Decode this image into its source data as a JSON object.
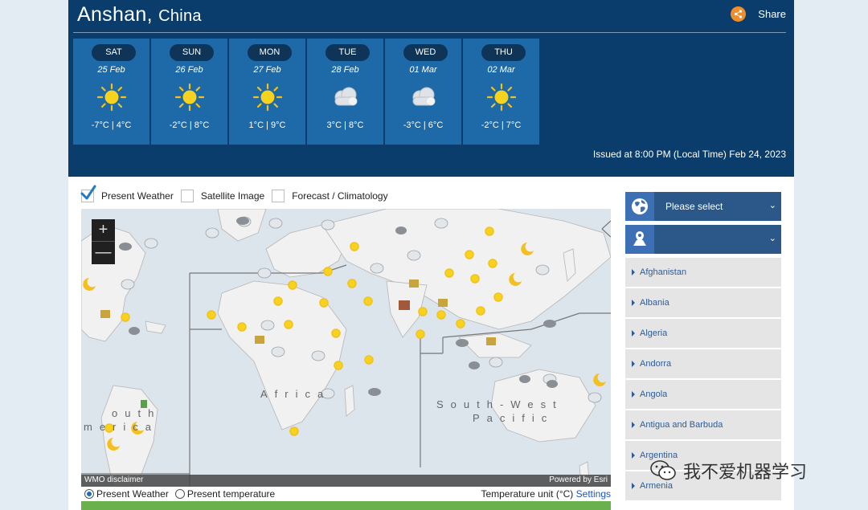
{
  "header": {
    "city": "Anshan,",
    "country": "China",
    "share_label": "Share",
    "issued": "Issued at 8:00 PM (Local Time) Feb 24, 2023"
  },
  "forecast": [
    {
      "day": "SAT",
      "date": "25 Feb",
      "icon": "sun-icon",
      "temp": "-7°C | 4°C"
    },
    {
      "day": "SUN",
      "date": "26 Feb",
      "icon": "sun-icon",
      "temp": "-2°C | 8°C"
    },
    {
      "day": "MON",
      "date": "27 Feb",
      "icon": "sun-icon",
      "temp": "1°C | 9°C"
    },
    {
      "day": "TUE",
      "date": "28 Feb",
      "icon": "cloud-icon",
      "temp": "3°C | 8°C"
    },
    {
      "day": "WED",
      "date": "01 Mar",
      "icon": "cloud-icon",
      "temp": "-3°C | 6°C"
    },
    {
      "day": "THU",
      "date": "02 Mar",
      "icon": "sun-icon",
      "temp": "-2°C | 7°C"
    }
  ],
  "map_options": {
    "present_weather": "Present Weather",
    "satellite_image": "Satellite Image",
    "forecast_climatology": "Forecast / Climatology"
  },
  "map": {
    "zoom_in": "+",
    "zoom_out": "—",
    "label_africa": "Africa",
    "label_south_america_1": "outh",
    "label_south_america_2": "merica",
    "label_sw_pacific_1": "South-West",
    "label_sw_pacific_2": "Pacific",
    "disclaimer": "WMO disclaimer",
    "powered_by": "Powered by Esri"
  },
  "bottom": {
    "present_weather": "Present Weather",
    "present_temperature": "Present temperature",
    "unit_text": "Temperature unit (°C)",
    "settings": "Settings"
  },
  "sidebar": {
    "region_select": "Please select",
    "countries": [
      "Afghanistan",
      "Albania",
      "Algeria",
      "Andorra",
      "Angola",
      "Antigua and Barbuda",
      "Argentina",
      "Armenia"
    ]
  },
  "watermark": "我不爱机器学习",
  "colors": {
    "header_bg": "#0a3d6b",
    "day_card": "#1e6aa8",
    "share_accent": "#f18e2b",
    "link": "#2d5c98"
  }
}
